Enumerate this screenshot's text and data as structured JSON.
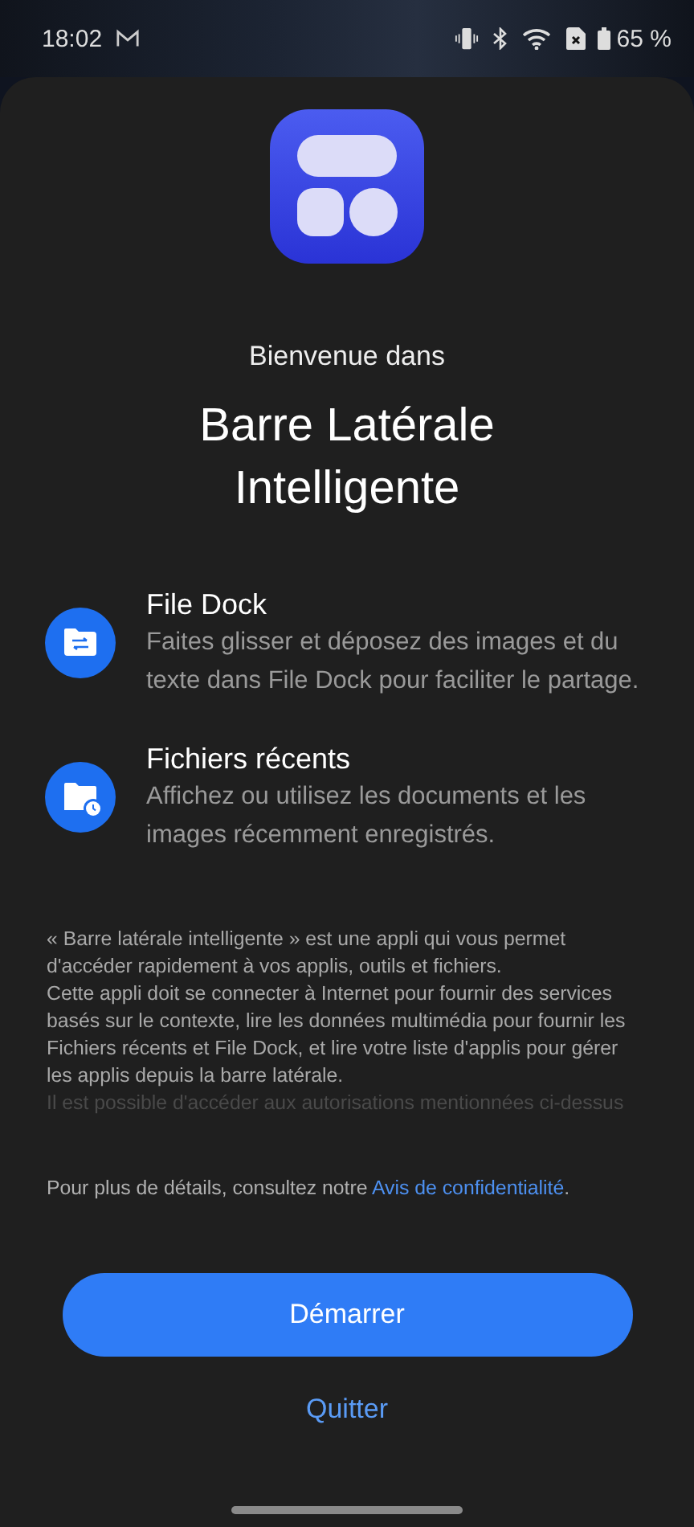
{
  "status_bar": {
    "time": "18:02",
    "battery": "65 %"
  },
  "header": {
    "subtitle": "Bienvenue dans",
    "title_lines": [
      "Barre Latérale",
      "Intelligente"
    ]
  },
  "features": [
    {
      "kind": "transfer",
      "title": "File Dock",
      "description": "Faites glisser et déposez des images et du texte dans File Dock pour faciliter le partage."
    },
    {
      "kind": "recent",
      "title": "Fichiers récents",
      "description": "Affichez ou utilisez les documents et les images récemment enregistrés."
    }
  ],
  "notice": {
    "paragraphs": [
      "« Barre latérale intelligente » est une appli qui vous permet d'accéder rapidement à vos applis, outils et fichiers.",
      "Cette appli doit se connecter à Internet pour fournir des services basés sur le contexte, lire les données multimédia pour fournir les Fichiers récents et File Dock, et lire votre liste d'applis pour gérer les applis depuis la barre latérale.",
      "Il est possible d'accéder aux autorisations mentionnées ci-dessus"
    ]
  },
  "privacy": {
    "text": "Pour plus de détails, consultez notre ",
    "link": "Avis de confidentialité",
    "end": "."
  },
  "buttons": {
    "primary": "Démarrer",
    "secondary": "Quitter"
  }
}
